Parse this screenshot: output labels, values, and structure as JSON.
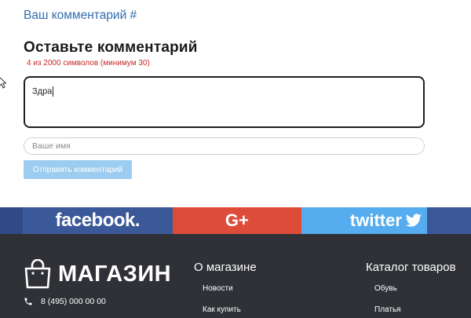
{
  "comment_header": {
    "link_text": "Ваш комментарий #"
  },
  "comment_form": {
    "title": "Оставьте комментарий",
    "counter": "4 из 2000 символов (минимум 30)",
    "comment_value": "Здра",
    "name_placeholder": "Ваше имя",
    "submit_label": "Отправить комментарий"
  },
  "social": {
    "facebook": "facebook.",
    "google": "G+",
    "twitter": "twitter",
    "colors": {
      "facebook": "#3b5998",
      "google": "#dd4b39",
      "twitter": "#55acee"
    }
  },
  "footer": {
    "logo_text": "МАГАЗИН",
    "phone": "8 (495) 000 00 00",
    "about": {
      "heading": "О магазине",
      "links": [
        "Новости",
        "Как купить"
      ]
    },
    "catalog": {
      "heading": "Каталог товаров",
      "links": [
        "Обувь",
        "Платья"
      ]
    }
  }
}
